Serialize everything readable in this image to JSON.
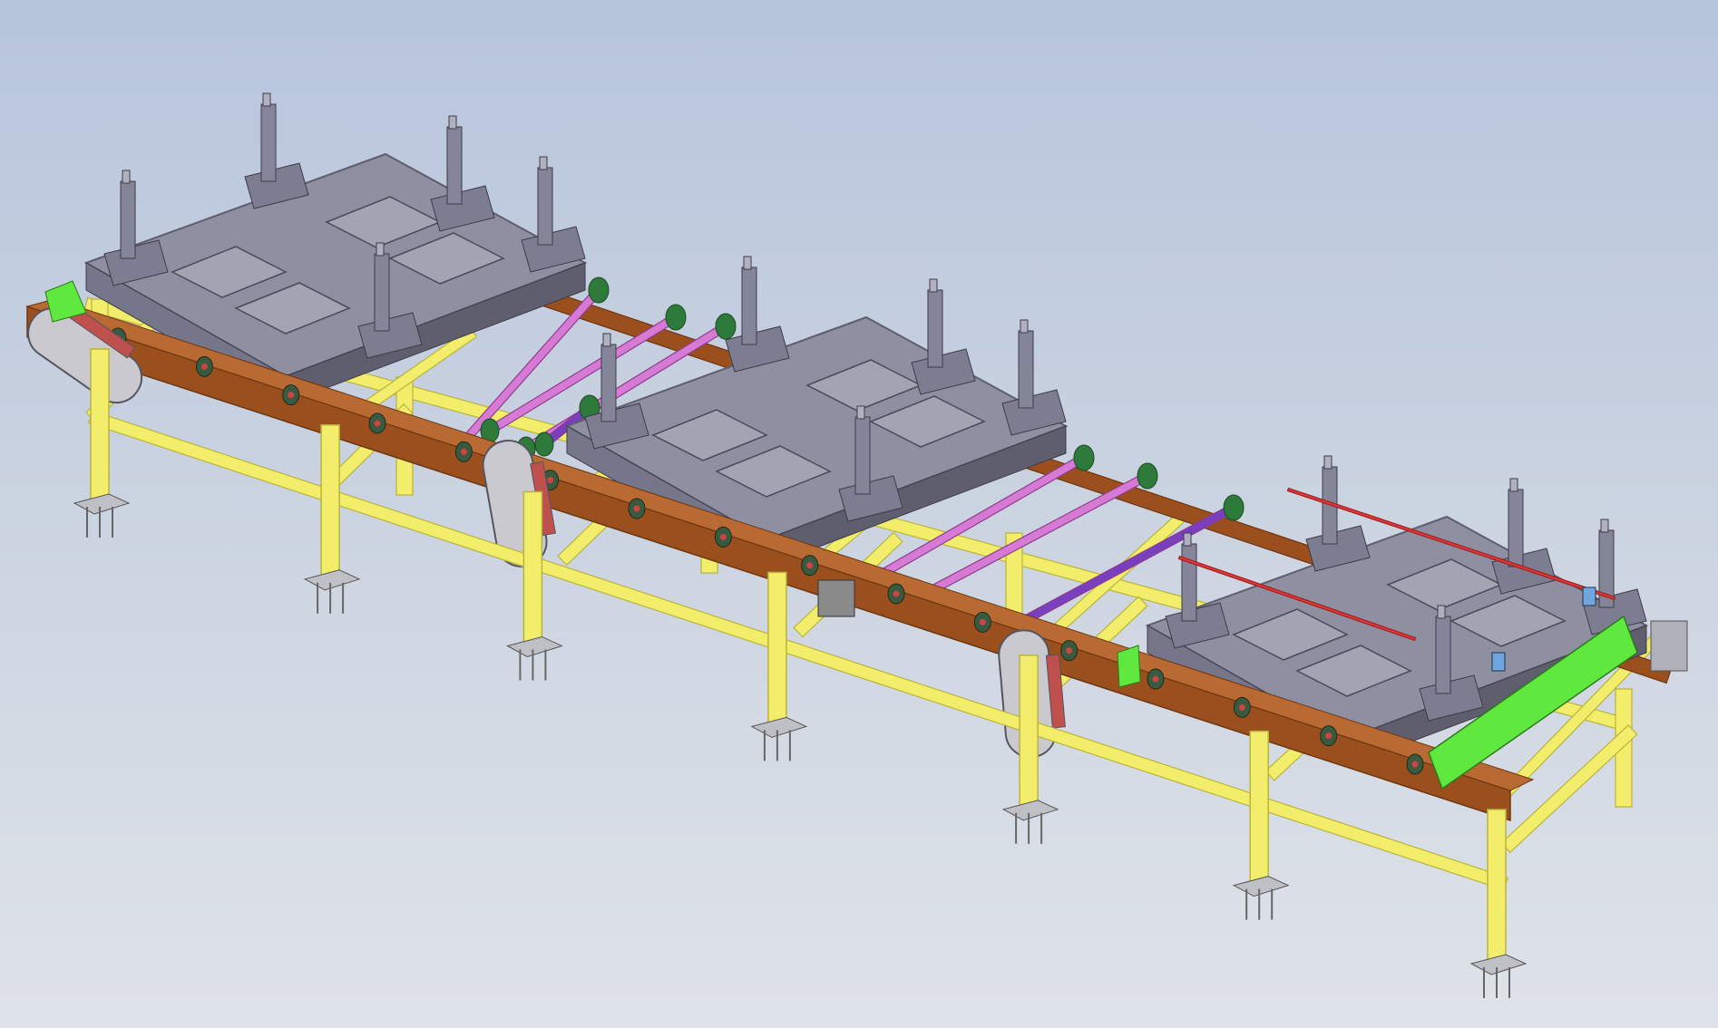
{
  "scene": {
    "background_top": "#b7c5dc",
    "background_bottom": "#dfe3e9",
    "colors": {
      "frame_yellow": "#f2ee6b",
      "frame_yellow_dark": "#b9b43c",
      "beam_brown": "#9b4f1c",
      "beam_brown_dark": "#6d3612",
      "fixture_gray": "#8f8fa2",
      "fixture_gray_dark": "#5e5e6f",
      "shaft_pink": "#d77ad6",
      "shaft_purple": "#7a3fbf",
      "motor_green": "#2d7a3a",
      "guard_green": "#5fe83d",
      "motor_housing": "#c9c9cf",
      "rail_red": "#e23a3a"
    },
    "stations": 3,
    "icons": [
      "conveyor-frame-icon",
      "pallet-fixture-icon",
      "drive-motor-icon",
      "leveling-foot-icon"
    ]
  }
}
